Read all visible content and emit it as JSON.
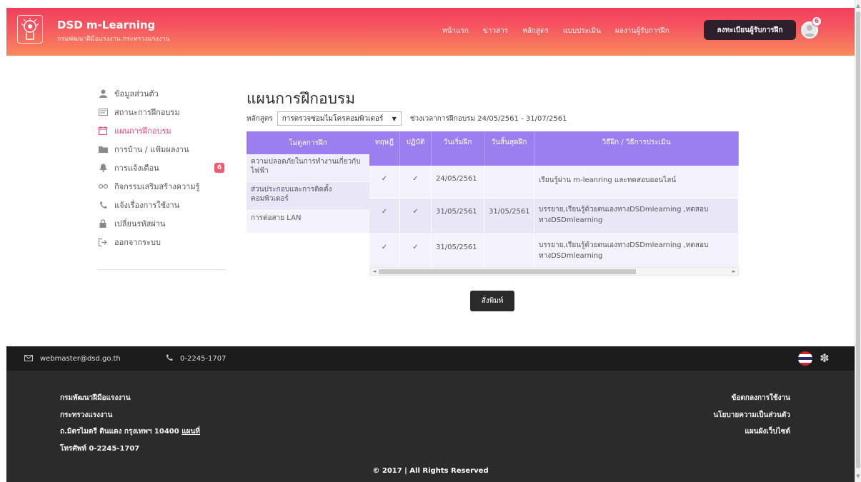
{
  "header": {
    "brand_title": "DSD m-Learning",
    "brand_sub": "กรมพัฒนาฝีมือแรงงาน กระทรวงแรงงาน",
    "nav": [
      "หน้าแรก",
      "ข่าวสาร",
      "หลักสูตร",
      "แบบประเมิน",
      "ผลงานผู้รับการฝึก"
    ],
    "register_label": "ลงทะเบียนผู้รับการฝึก",
    "avatar_badge": "6"
  },
  "sidebar": {
    "items": [
      {
        "label": "ข้อมูลส่วนตัว",
        "icon": "user-icon"
      },
      {
        "label": "สถานะการฝึกอบรม",
        "icon": "status-card-icon"
      },
      {
        "label": "แผนการฝึกอบรม",
        "icon": "calendar-icon"
      },
      {
        "label": "การบ้าน / แฟ้มผลงาน",
        "icon": "folder-icon"
      },
      {
        "label": "การแจ้งเตือน",
        "icon": "bell-icon",
        "badge": "6"
      },
      {
        "label": "กิจกรรมเสริมสร้างความรู้",
        "icon": "glasses-icon"
      },
      {
        "label": "แจ้งเรื่องการใช้งาน",
        "icon": "phone-icon"
      },
      {
        "label": "เปลี่ยนรหัสผ่าน",
        "icon": "lock-icon"
      },
      {
        "label": "ออกจากระบบ",
        "icon": "logout-icon"
      }
    ],
    "active_index": 2
  },
  "main": {
    "title": "แผนการฝึกอบรม",
    "course_label": "หลักสูตร",
    "course_value": "การตรวจซ่อมไมโครคอมพิวเตอร์",
    "period": "ช่วงเวลาการฝึกอบรม 24/05/2561 - 31/07/2561",
    "table": {
      "module_header": "โมดูลการฝึก",
      "headers": [
        "ทฤษฎี",
        "ปฏิบัติ",
        "วันเริ่มฝึก",
        "วันสิ้นสุดฝึก",
        "วิธีฝึก / วิธีการประเมิน"
      ],
      "rows": [
        {
          "module": "ความปลอดภัยในการทำงานเกี่ยวกับไฟฟ้า",
          "theory": "✓",
          "practice": "✓",
          "start": "24/05/2561",
          "end": "",
          "method": "เรียนรู้ผ่าน m-leanring และทดสอบออนไลน์"
        },
        {
          "module": "ส่วนประกอบและการติดตั้งคอมพิวเตอร์",
          "theory": "✓",
          "practice": "✓",
          "start": "31/05/2561",
          "end": "31/05/2561",
          "method": "บรรยาย,เรียนรู้ด้วยตนเองทางDSDmlearning ,ทดสอบทางDSDmlearning"
        },
        {
          "module": "การต่อสาย LAN",
          "theory": "✓",
          "practice": "✓",
          "start": "31/05/2561",
          "end": "",
          "method": "บรรยาย,เรียนรู้ด้วยตนเองทางDSDmlearning ,ทดสอบทางDSDmlearning"
        }
      ]
    },
    "print_label": "สั่งพิมพ์"
  },
  "footer": {
    "email": "webmaster@dsd.go.th",
    "phone": "0-2245-1707",
    "left_lines": [
      "กรมพัฒนาฝีมือแรงงาน",
      "กระทรวงแรงงาน",
      "ถ.มิตรไมตรี ดินแดง กรุงเทพฯ 10400",
      "โทรศัพท์ 0-2245-1707"
    ],
    "map_link": "แผนที่",
    "right_links": [
      "ข้อตกลงการใช้งาน",
      "นโยบายความเป็นส่วนตัว",
      "แผนผังเว็บไซต์"
    ],
    "copyright": "© 2017 | All Rights Reserved"
  },
  "colors": {
    "header_gradient_start": "#f33e5c",
    "header_gradient_end": "#f98a5b",
    "table_header": "#9b7ef0",
    "active_menu": "#e9477a",
    "footer_dark": "#2b2b2b"
  }
}
